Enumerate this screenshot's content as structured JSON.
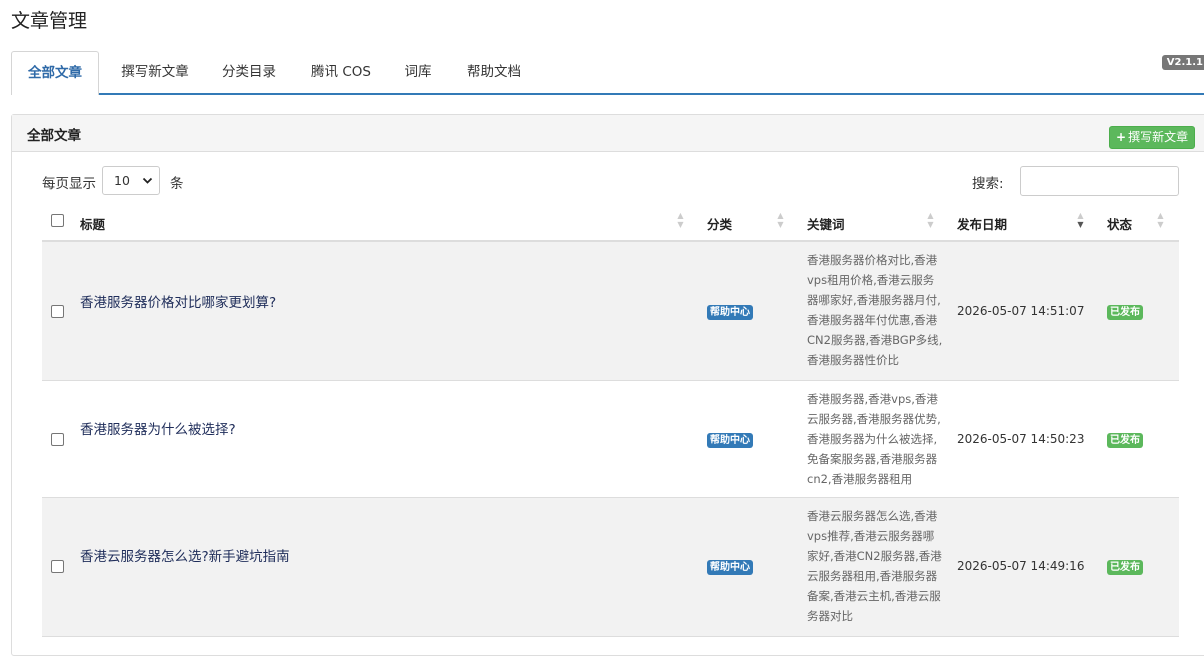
{
  "page": {
    "title": "文章管理",
    "version": "V2.1.1"
  },
  "tabs": [
    {
      "label": "全部文章",
      "active": true
    },
    {
      "label": "撰写新文章"
    },
    {
      "label": "分类目录"
    },
    {
      "label": "腾讯 COS"
    },
    {
      "label": "词库"
    },
    {
      "label": "帮助文档"
    }
  ],
  "panel": {
    "title": "全部文章",
    "new_button": "撰写新文章"
  },
  "length": {
    "prefix": "每页显示",
    "value": "10",
    "suffix": "条"
  },
  "search": {
    "label": "搜索:",
    "value": ""
  },
  "columns": {
    "title": "标题",
    "category": "分类",
    "keywords": "关键词",
    "date": "发布日期",
    "status": "状态"
  },
  "rows": [
    {
      "title": "香港服务器价格对比哪家更划算?",
      "category": "帮助中心",
      "keywords": "香港服务器价格对比,香港vps租用价格,香港云服务器哪家好,香港服务器月付,香港服务器年付优惠,香港CN2服务器,香港BGP多线,香港服务器性价比",
      "date": "2026-05-07 14:51:07",
      "status": "已发布"
    },
    {
      "title": "香港服务器为什么被选择?",
      "category": "帮助中心",
      "keywords": "香港服务器,香港vps,香港云服务器,香港服务器优势,香港服务器为什么被选择,免备案服务器,香港服务器cn2,香港服务器租用",
      "date": "2026-05-07 14:50:23",
      "status": "已发布"
    },
    {
      "title": "香港云服务器怎么选?新手避坑指南",
      "category": "帮助中心",
      "keywords": "香港云服务器怎么选,香港vps推荐,香港云服务器哪家好,香港CN2服务器,香港云服务器租用,香港服务器备案,香港云主机,香港云服务器对比",
      "date": "2026-05-07 14:49:16",
      "status": "已发布"
    }
  ]
}
